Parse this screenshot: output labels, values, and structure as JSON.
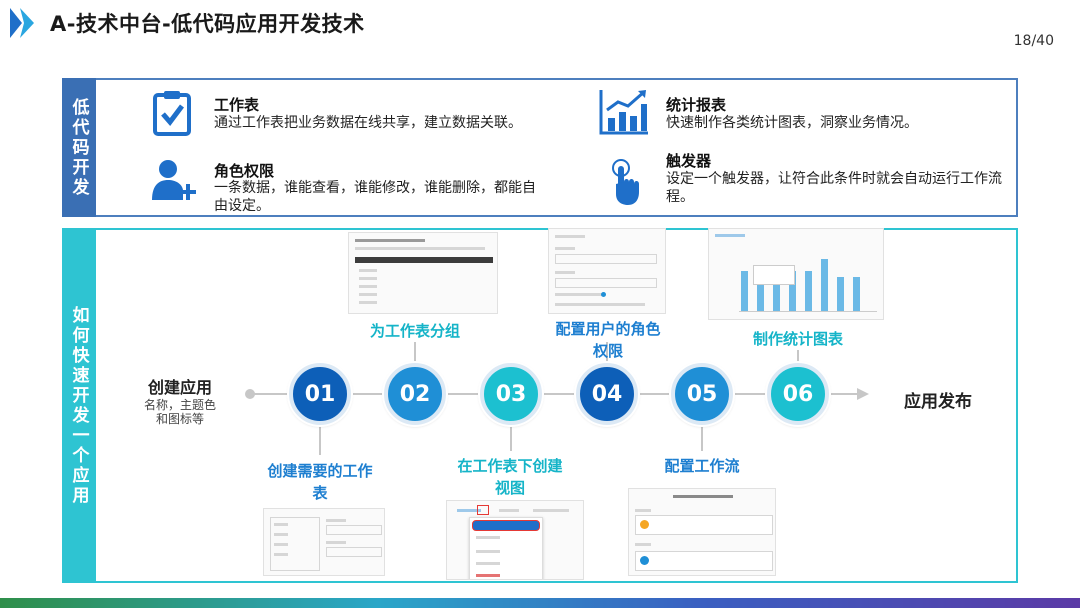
{
  "header": {
    "title": "A-技术中台-低代码应用开发技术",
    "page": "18/40"
  },
  "section1": {
    "side_label": "低代码开发",
    "features": [
      {
        "icon": "clipboard-check-icon",
        "title": "工作表",
        "desc": "通过工作表把业务数据在线共享，建立数据关联。"
      },
      {
        "icon": "user-add-icon",
        "title": "角色权限",
        "desc": "一条数据，谁能查看，谁能修改，谁能删除，都能自由设定。"
      },
      {
        "icon": "bar-chart-icon",
        "title": "统计报表",
        "desc": "快速制作各类统计图表，洞察业务情况。"
      },
      {
        "icon": "touch-hand-icon",
        "title": "触发器",
        "desc": "设定一个触发器，让符合此条件时就会自动运行工作流程。"
      }
    ]
  },
  "section2": {
    "side_label": "如何快速开发一个应用",
    "start": {
      "title": "创建应用",
      "sub1": "名称，主题色",
      "sub2": "和图标等"
    },
    "end": "应用发布",
    "steps": [
      {
        "num": "01",
        "label1": "创建需要的工作",
        "label2": "表"
      },
      {
        "num": "02",
        "label1": "为工作表分组",
        "label2": ""
      },
      {
        "num": "03",
        "label1": "在工作表下创建",
        "label2": "视图"
      },
      {
        "num": "04",
        "label1": "配置用户的角色",
        "label2": "权限"
      },
      {
        "num": "05",
        "label1": "配置工作流",
        "label2": ""
      },
      {
        "num": "06",
        "label1": "制作统计图表",
        "label2": ""
      }
    ],
    "colors": {
      "dark": "#0d5fb8",
      "mid": "#1f8fd6",
      "light": "#1cc0d0",
      "text_dark": "#1e7fd0",
      "text_light": "#15b4c8"
    }
  }
}
